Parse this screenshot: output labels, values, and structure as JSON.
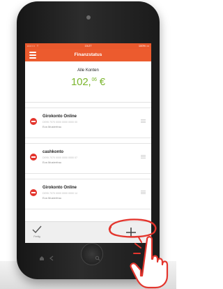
{
  "app": {
    "status_bar": {
      "signal": "•••○○ ⌔",
      "time": "15:27",
      "battery": "100% ▭"
    },
    "title": "Finanzstatus"
  },
  "summary": {
    "label": "Alle Konten",
    "amount_main": "102,",
    "amount_cents": "06",
    "currency": "€"
  },
  "accounts": [
    {
      "name": "Girokonto Online",
      "iban": "DE95 7070 0000 0000 0000 00",
      "owner": "Eva Musterfrau"
    },
    {
      "name": "cashkonto",
      "iban": "DE95 7070 0000 0000 0000 07",
      "owner": "Eva Musterfrau"
    },
    {
      "name": "Girokonto Online",
      "iban": "DE95 7070 0000 0000 0000 14",
      "owner": "Eva Musterfrau"
    }
  ],
  "toolbar": {
    "done_label": "Fertig",
    "add_icon": "plus-icon",
    "done_icon": "check-icon"
  },
  "colors": {
    "brand": "#ec5b2e",
    "amount": "#7ab52d",
    "delete": "#e3352d",
    "highlight": "#e3352d"
  }
}
